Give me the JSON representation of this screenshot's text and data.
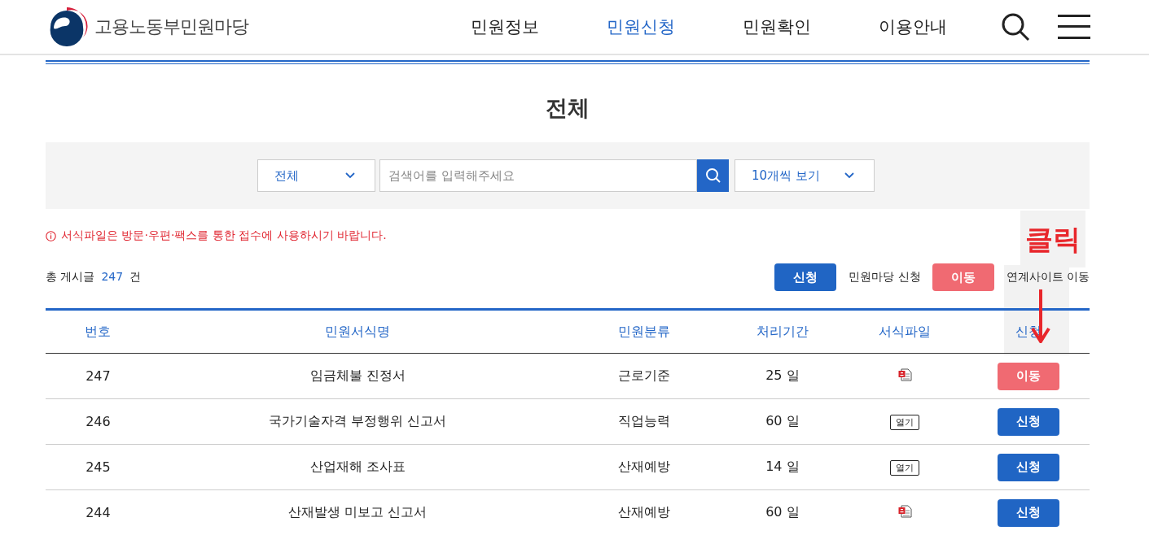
{
  "header": {
    "logo_text": "고용노동부민원마당",
    "nav": [
      {
        "label": "민원정보",
        "selected": false
      },
      {
        "label": "민원신청",
        "selected": true
      },
      {
        "label": "민원확인",
        "selected": false
      },
      {
        "label": "이용안내",
        "selected": false
      }
    ]
  },
  "page_title": "전체",
  "search": {
    "category": "전체",
    "placeholder": "검색어를 입력해주세요",
    "page_size": "10개씩 보기"
  },
  "notice": "서식파일은 방문·우편·팩스를 통한 접수에 사용하시기 바랍니다.",
  "count": {
    "label": "총 게시글",
    "value": "247",
    "unit": "건"
  },
  "legend": [
    {
      "kind": "apply",
      "button": "신청",
      "text": "민원마당 신청"
    },
    {
      "kind": "move",
      "button": "이동",
      "text": "연계사이트 이동"
    }
  ],
  "annotation": {
    "text": "클릭"
  },
  "table": {
    "columns": [
      "번호",
      "민원서식명",
      "민원분류",
      "처리기간",
      "서식파일",
      "신청"
    ],
    "rows": [
      {
        "number": "247",
        "name": "임금체불 진정서",
        "category": "근로기준",
        "period": "25 일",
        "file": {
          "kind": "icon"
        },
        "action": {
          "kind": "move",
          "label": "이동"
        }
      },
      {
        "number": "246",
        "name": "국가기술자격 부정행위 신고서",
        "category": "직업능력",
        "period": "60 일",
        "file": {
          "kind": "open",
          "label": "열기"
        },
        "action": {
          "kind": "apply",
          "label": "신청"
        }
      },
      {
        "number": "245",
        "name": "산업재해 조사표",
        "category": "산재예방",
        "period": "14 일",
        "file": {
          "kind": "open",
          "label": "열기"
        },
        "action": {
          "kind": "apply",
          "label": "신청"
        }
      },
      {
        "number": "244",
        "name": "산재발생 미보고 신고서",
        "category": "산재예방",
        "period": "60 일",
        "file": {
          "kind": "icon"
        },
        "action": {
          "kind": "apply",
          "label": "신청"
        }
      }
    ]
  }
}
